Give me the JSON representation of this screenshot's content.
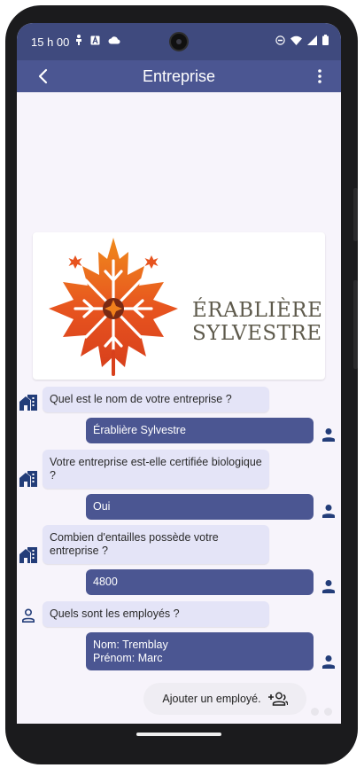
{
  "status": {
    "time": "15 h 00"
  },
  "appbar": {
    "title": "Entreprise"
  },
  "logo": {
    "line1": "ÉRABLIÈRE",
    "line2": "SYLVESTRE"
  },
  "chat": [
    {
      "q": "Quel est le nom de votre entreprise ?",
      "a": "Érablière Sylvestre"
    },
    {
      "q": "Votre entreprise est-elle certifiée biologique ?",
      "a": "Oui"
    },
    {
      "q": "Combien d'entailles possède votre entreprise ?",
      "a": "4800"
    },
    {
      "q": "Quels sont les employés ?",
      "a_line1": "Nom: Tremblay",
      "a_line2": "Prénom: Marc"
    }
  ],
  "add_employee": {
    "label": "Ajouter un employé."
  },
  "colors": {
    "statusbar": "#3f4a7e",
    "appbar": "#4b5692",
    "question_bubble": "#e4e4f7",
    "answer_bubble": "#4b5692",
    "icon": "#233d79"
  }
}
